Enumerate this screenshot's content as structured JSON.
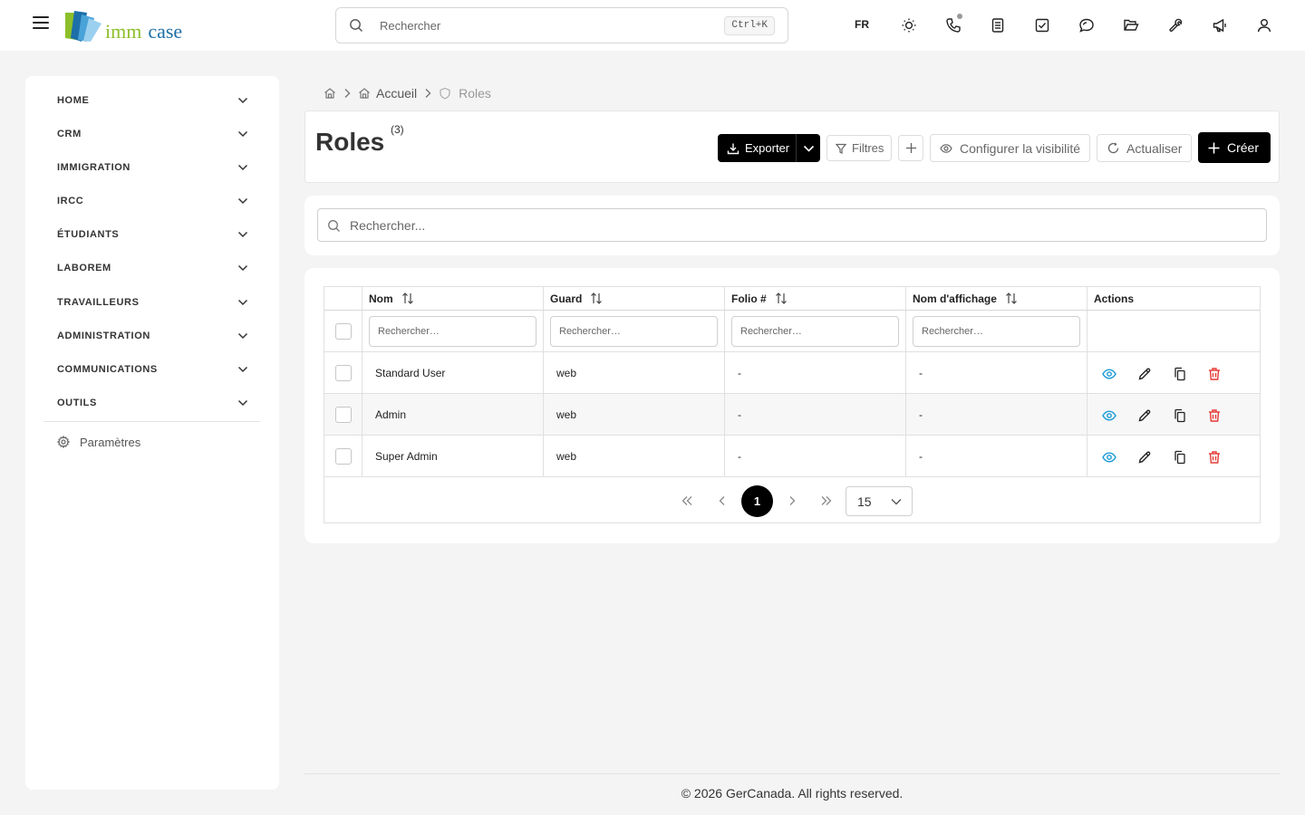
{
  "brand": {
    "part1": "imm",
    "part2": "case"
  },
  "search": {
    "placeholder": "Rechercher",
    "shortcut": "Ctrl+K"
  },
  "header": {
    "language": "FR"
  },
  "sidebar": {
    "items": [
      {
        "label": "HOME"
      },
      {
        "label": "CRM"
      },
      {
        "label": "IMMIGRATION"
      },
      {
        "label": "IRCC"
      },
      {
        "label": "ÉTUDIANTS"
      },
      {
        "label": "LABOREM"
      },
      {
        "label": "TRAVAILLEURS"
      },
      {
        "label": "ADMINISTRATION"
      },
      {
        "label": "COMMUNICATIONS"
      },
      {
        "label": "OUTILS"
      }
    ],
    "settings_label": "Paramètres"
  },
  "breadcrumb": {
    "home": "Accueil",
    "current": "Roles"
  },
  "page": {
    "title": "Roles",
    "count": "(3)",
    "buttons": {
      "export": "Exporter",
      "filters": "Filtres",
      "visibility": "Configurer la visibilité",
      "refresh": "Actualiser",
      "create": "Créer"
    }
  },
  "table_search": {
    "placeholder": "Rechercher..."
  },
  "table": {
    "columns": [
      "Nom",
      "Guard",
      "Folio #",
      "Nom d'affichage",
      "Actions"
    ],
    "filter_placeholder": "Rechercher…",
    "rows": [
      {
        "name": "Standard User",
        "guard": "web",
        "folio": "-",
        "display_name": "-"
      },
      {
        "name": "Admin",
        "guard": "web",
        "folio": "-",
        "display_name": "-"
      },
      {
        "name": "Super Admin",
        "guard": "web",
        "folio": "-",
        "display_name": "-"
      }
    ]
  },
  "pagination": {
    "current_page": "1",
    "per_page": "15"
  },
  "colors": {
    "view": "#1a9ad6",
    "delete": "#e53935",
    "primary": "#000000",
    "logo_green": "#8cbf2a",
    "logo_blue": "#1c6fa8"
  },
  "footer": {
    "text": "© 2026 GerCanada. All rights reserved."
  }
}
